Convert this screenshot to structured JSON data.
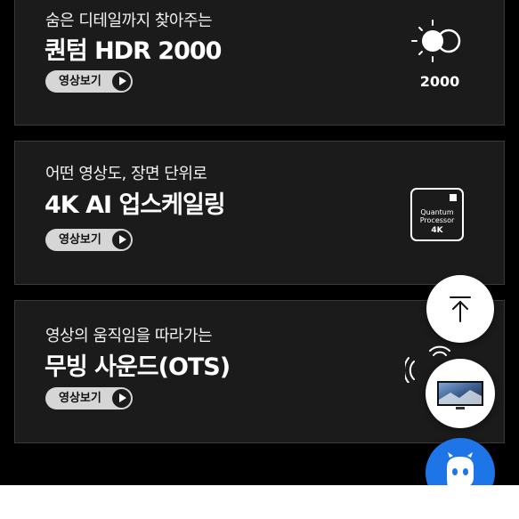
{
  "features": [
    {
      "subtitle": "숨은 디테일까지 찾아주는",
      "title": "퀀텀 HDR 2000",
      "button": "영상보기",
      "icon": "hdr-2000-icon",
      "icon_caption": "2000"
    },
    {
      "subtitle": "어떤 영상도, 장면 단위로",
      "title": "4K AI 업스케일링",
      "button": "영상보기",
      "icon": "quantum-processor-4k-icon",
      "chip": {
        "line1": "Quantum",
        "line2": "Processor",
        "line3": "4K"
      }
    },
    {
      "subtitle": "영상의 움직임을 따라가는",
      "title": "무빙 사운드(OTS)",
      "button": "영상보기",
      "icon": "object-tracking-sound-icon"
    }
  ],
  "floating": {
    "scroll_top_icon": "arrow-up-icon",
    "thumbnail_icon": "tv-thumbnail-icon",
    "chat_icon": "chatbot-icon"
  },
  "colors": {
    "background": "#000000",
    "card": "#1b1b1b",
    "button": "#d6d6d6",
    "chat": "#1e75e8"
  }
}
